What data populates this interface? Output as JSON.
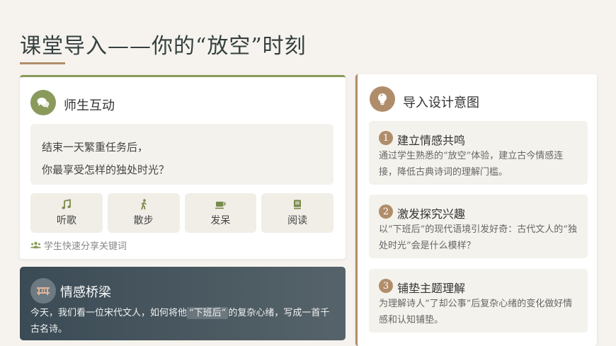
{
  "page": {
    "title": "课堂导入——你的“放空”时刻"
  },
  "interaction": {
    "heading": "师生互动",
    "question_line1": "结束一天繁重任务后，",
    "question_line2": "你最享受怎样的独处时光？",
    "activities": [
      {
        "label": "听歌",
        "icon": "music-note-icon"
      },
      {
        "label": "散步",
        "icon": "walking-icon"
      },
      {
        "label": "发呆",
        "icon": "coffee-cup-icon"
      },
      {
        "label": "阅读",
        "icon": "book-icon"
      }
    ],
    "hint": "学生快速分享关键词"
  },
  "bridge": {
    "heading": "情感桥梁",
    "text_before": "今天，我们看一位宋代文人，如何将他",
    "highlight": "“下班后”",
    "text_after": "的复杂心绪，写成一首千古名诗。"
  },
  "design": {
    "heading": "导入设计意图",
    "goals": [
      {
        "num": "1",
        "title": "建立情感共鸣",
        "desc": "通过学生熟悉的“放空”体验，建立古今情感连接，降低古典诗词的理解门槛。"
      },
      {
        "num": "2",
        "title": "激发探究兴趣",
        "desc": "以“下班后”的现代语境引发好奇：古代文人的“独处时光”会是什么模样？"
      },
      {
        "num": "3",
        "title": "铺垫主题理解",
        "desc": "为理解诗人“了却公事”后复杂心绪的变化做好情感和认知铺垫。"
      }
    ]
  },
  "colors": {
    "olive": "#8a9a5b",
    "tan": "#b08d6a",
    "slate": "#3b4b55"
  }
}
